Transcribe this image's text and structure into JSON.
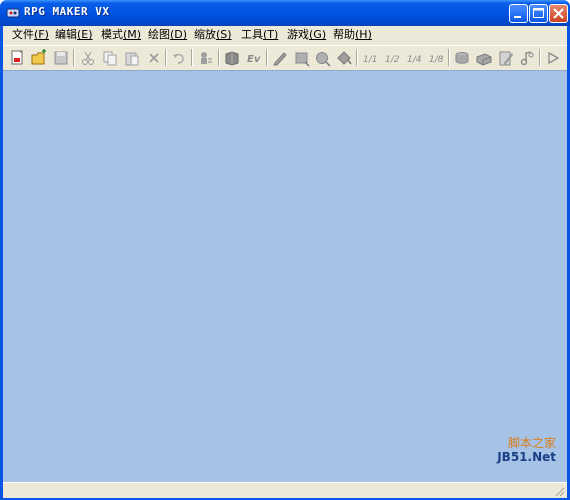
{
  "window": {
    "title": "RPG MAKER VX"
  },
  "title_buttons": [
    "minimize-icon",
    "maximize-icon",
    "close-icon"
  ],
  "menubar": {
    "items": [
      {
        "label": "文件",
        "accel": "(F)"
      },
      {
        "label": "编辑",
        "accel": "(E)"
      },
      {
        "label": "模式",
        "accel": "(M)"
      },
      {
        "label": "绘图",
        "accel": "(D)"
      },
      {
        "label": "缩放",
        "accel": "(S)"
      },
      {
        "label": "工具",
        "accel": "(T)"
      },
      {
        "label": "游戏",
        "accel": "(G)"
      },
      {
        "label": "帮助",
        "accel": "(H)"
      }
    ]
  },
  "toolbar": {
    "tools": [
      "new-project-icon",
      "open-project-icon",
      "save-project-icon",
      "cut-icon",
      "copy-icon",
      "paste-icon",
      "delete-icon",
      "undo-icon",
      "map-layer-icon",
      "event-layer-icon",
      "event-mode-icon",
      "pencil-icon",
      "rectangle-icon",
      "ellipse-icon",
      "fill-icon",
      "zoom-1-1-icon",
      "zoom-1-2-icon",
      "zoom-1-4-icon",
      "zoom-1-8-icon",
      "database-icon",
      "material-base-icon",
      "script-editor-icon",
      "sound-test-icon",
      "playtest-icon"
    ]
  },
  "watermark": {
    "line1": "脚本之家",
    "line2": "JB51.Net"
  },
  "colors": {
    "titlebar": "#0054e3",
    "frame": "#ece9d8",
    "workspace": "#a6c2e6"
  }
}
